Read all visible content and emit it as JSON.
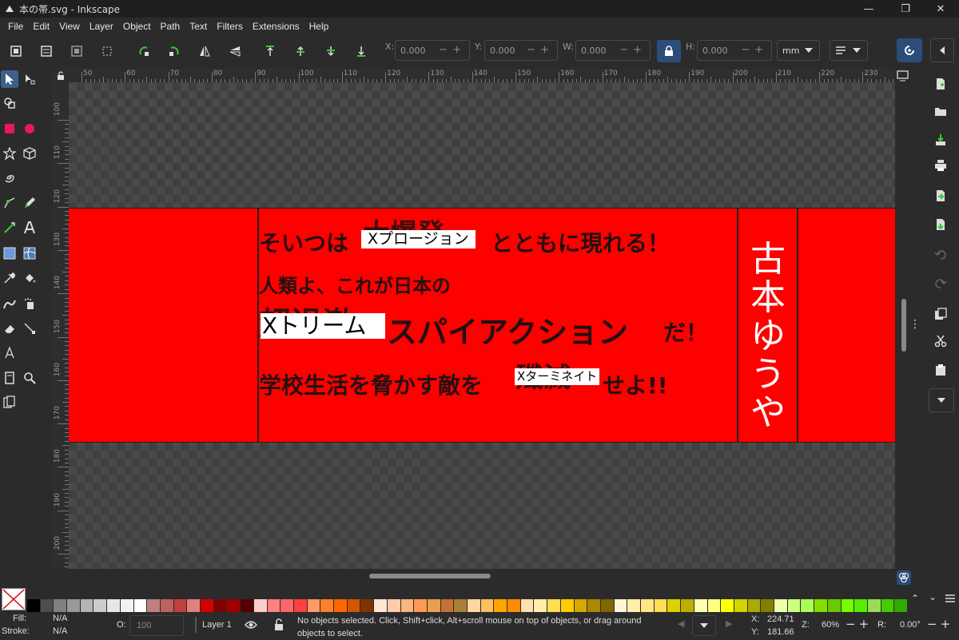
{
  "window": {
    "title": "本の帯.svg - Inkscape",
    "btn_min": "—",
    "btn_max": "❐",
    "btn_close": "✕"
  },
  "menu": [
    "File",
    "Edit",
    "View",
    "Layer",
    "Object",
    "Path",
    "Text",
    "Filters",
    "Extensions",
    "Help"
  ],
  "toolbar": {
    "x_label": "X:",
    "x_value": "0.000",
    "y_label": "Y:",
    "y_value": "0.000",
    "w_label": "W:",
    "w_value": "0.000",
    "h_label": "H:",
    "h_value": "0.000",
    "unit": "mm"
  },
  "ruler": {
    "h_labels": [
      "50",
      "60",
      "70",
      "80",
      "90",
      "100",
      "110",
      "120",
      "130",
      "140",
      "150",
      "160",
      "170",
      "180",
      "190",
      "200",
      "210",
      "220",
      "230"
    ],
    "v_labels": [
      "100",
      "110",
      "120",
      "130",
      "140",
      "150",
      "160",
      "170",
      "180",
      "190",
      "200"
    ]
  },
  "doc": {
    "line1_before": "そいつは",
    "line1_struck": "大爆発",
    "line1_label": "Xプロージョン",
    "line1_after": "とともに現れる！",
    "line2": "人類よ、これが日本の",
    "line3_struck": "超過激",
    "line3_label": "Xトリーム",
    "line3_after": "スパイアクション",
    "line3_end": "だ！",
    "line4_before": "学校生活を脅かす敵を",
    "line4_struck": "殲滅",
    "line4_label": "Xターミネイト",
    "line4_after": "せよ!!",
    "author": [
      "古",
      "本",
      "ゆ",
      "う",
      "や"
    ],
    "band_color": "#ff0000"
  },
  "palette_colors": [
    "#000000",
    "#4d4d4d",
    "#808080",
    "#999999",
    "#b3b3b3",
    "#cccccc",
    "#e6e6e6",
    "#f2f2f2",
    "#ffffff",
    "#c08080",
    "#c06060",
    "#c04040",
    "#e08080",
    "#d40000",
    "#800000",
    "#a00000",
    "#550000",
    "#ffcccc",
    "#ff8080",
    "#ff6666",
    "#ff4040",
    "#ff9966",
    "#ff7f2a",
    "#ff6600",
    "#d45500",
    "#803300",
    "#ffe6d5",
    "#ffccaa",
    "#ffb380",
    "#ff9955",
    "#e6a050",
    "#c87137",
    "#aa7f39",
    "#ffd5a0",
    "#ffbf60",
    "#ffa500",
    "#ff8c00",
    "#ffe0b0",
    "#ffeeaa",
    "#ffdd55",
    "#ffcc00",
    "#d4aa00",
    "#aa8800",
    "#806600",
    "#fff6d5",
    "#ffeeaa",
    "#ffe680",
    "#ffdd55",
    "#ddd000",
    "#bbb000",
    "#ffffb0",
    "#ffff80",
    "#ffff00",
    "#d4d400",
    "#aaaa00",
    "#808000",
    "#eeffaa",
    "#ccff80",
    "#aaff55",
    "#88dd00",
    "#66cc00",
    "#77ff00",
    "#55ee00",
    "#99dd55",
    "#44cc00",
    "#33aa00"
  ],
  "status": {
    "fill_label": "Fill:",
    "fill_value": "N/A",
    "stroke_label": "Stroke:",
    "stroke_value": "N/A",
    "opacity_label": "O:",
    "opacity_value": "100",
    "layer": "Layer 1",
    "message": "No objects selected. Click, Shift+click, Alt+scroll mouse on top of objects, or drag around objects to select.",
    "x_label": "X:",
    "x_value": "224.71",
    "y_label": "Y:",
    "y_value": "181.66",
    "zoom_label": "Z:",
    "zoom_value": "60%",
    "rot_label": "R:",
    "rot_value": "0.00°"
  }
}
